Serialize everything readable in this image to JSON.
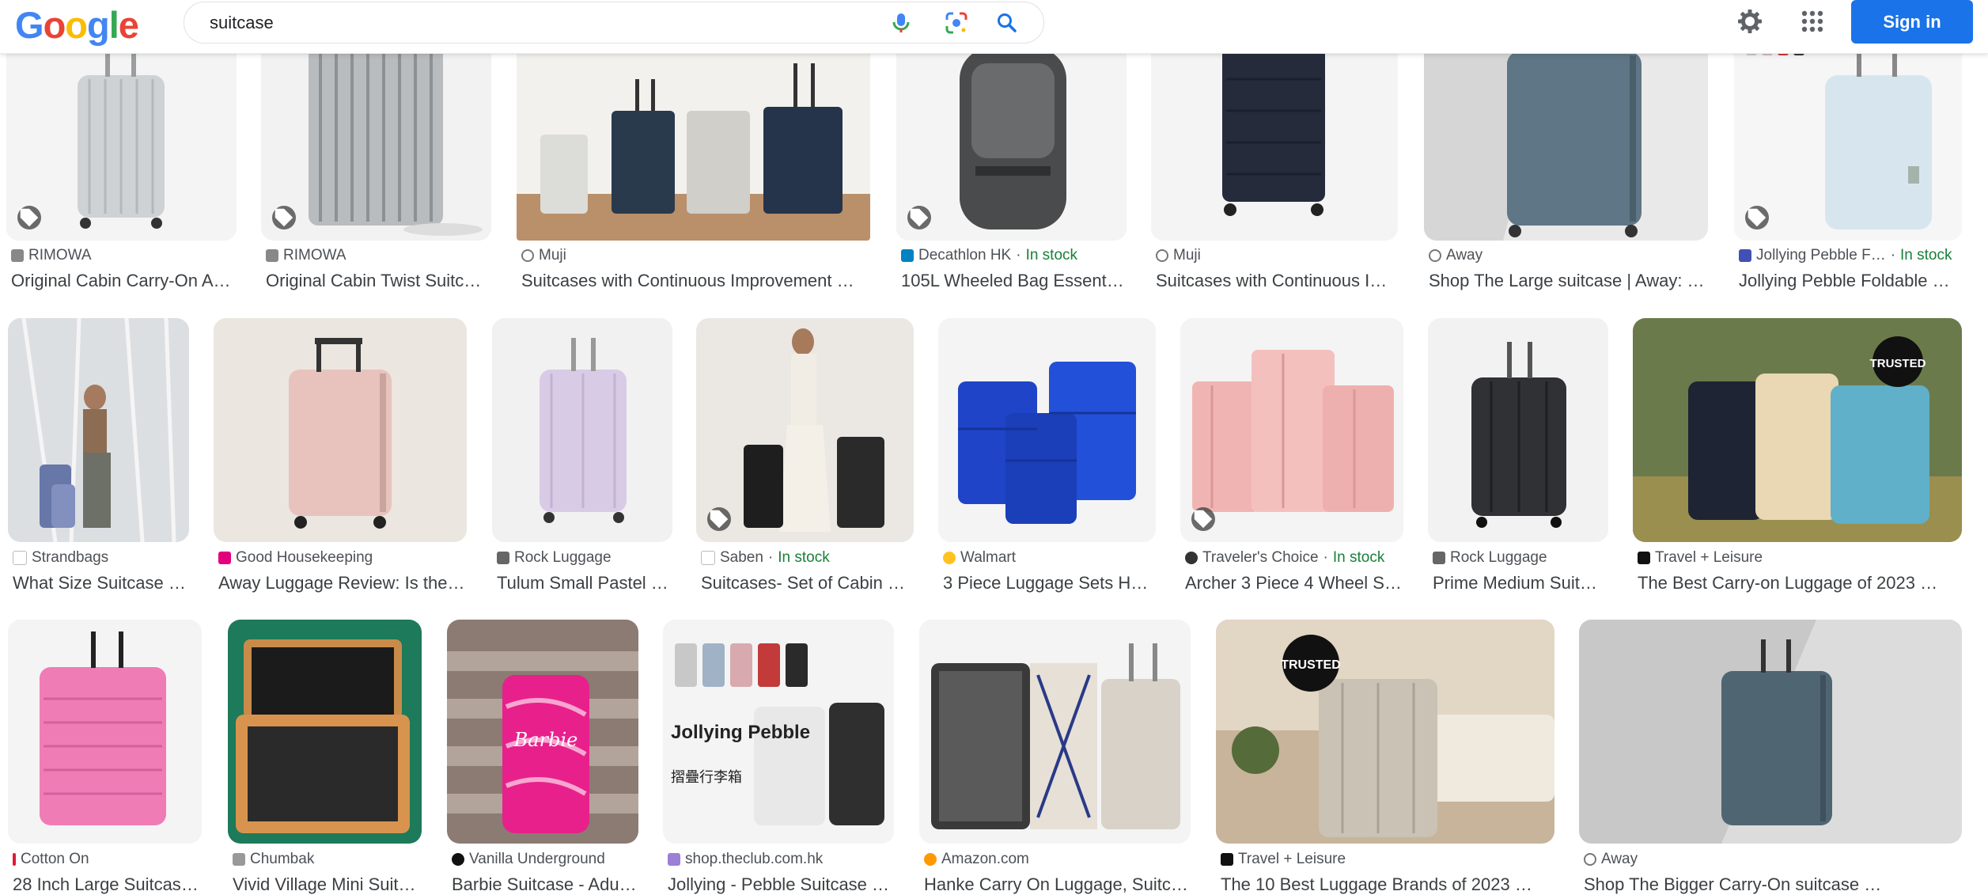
{
  "header": {
    "logo_text": "Google",
    "search_value": "suitcase",
    "signin_label": "Sign in"
  },
  "colors": {
    "accent": "#1a73e8",
    "in_stock": "#188038",
    "search_border": "#dfe1e5"
  },
  "results": [
    {
      "source": "RIMOWA",
      "stock": "",
      "title": "Original Cabin Carry-On A…",
      "icon": "rimowa-icon",
      "tag": true
    },
    {
      "source": "RIMOWA",
      "stock": "",
      "title": "Original Cabin Twist Suitc…",
      "icon": "rimowa-icon",
      "tag": true
    },
    {
      "source": "Muji",
      "stock": "",
      "title": "Suitcases with Continuous Improvement …",
      "icon": "globe-icon",
      "tag": false
    },
    {
      "source": "Decathlon HK",
      "stock": "In stock",
      "title": "105L Wheeled Bag Essent…",
      "icon": "decathlon-icon",
      "tag": true
    },
    {
      "source": "Muji",
      "stock": "",
      "title": "Suitcases with Continuous I…",
      "icon": "globe-icon",
      "tag": false
    },
    {
      "source": "Away",
      "stock": "",
      "title": "Shop The Large suitcase | Away: …",
      "icon": "away-icon",
      "tag": false
    },
    {
      "source": "Jollying Pebble F…",
      "stock": "In stock",
      "title": "Jollying Pebble Foldable …",
      "icon": "jollying-icon",
      "tag": true
    },
    {
      "source": "Strandbags",
      "stock": "",
      "title": "What Size Suitcase …",
      "icon": "strandbags-icon",
      "tag": false
    },
    {
      "source": "Good Housekeeping",
      "stock": "",
      "title": "Away Luggage Review: Is the…",
      "icon": "gh-icon",
      "tag": false
    },
    {
      "source": "Rock Luggage",
      "stock": "",
      "title": "Tulum Small Pastel …",
      "icon": "rock-icon",
      "tag": false
    },
    {
      "source": "Saben",
      "stock": "In stock",
      "title": "Suitcases- Set of Cabin …",
      "icon": "saben-icon",
      "tag": true
    },
    {
      "source": "Walmart",
      "stock": "",
      "title": "3 Piece Luggage Sets H…",
      "icon": "walmart-icon",
      "tag": false
    },
    {
      "source": "Traveler's Choice",
      "stock": "In stock",
      "title": "Archer 3 Piece 4 Wheel S…",
      "icon": "travelers-icon",
      "tag": true
    },
    {
      "source": "Rock Luggage",
      "stock": "",
      "title": "Prime Medium Suit…",
      "icon": "rock-icon",
      "tag": false
    },
    {
      "source": "Travel + Leisure",
      "stock": "",
      "title": "The Best Carry-on Luggage of 2023 …",
      "icon": "tl-icon",
      "tag": false
    },
    {
      "source": "Cotton On",
      "stock": "",
      "title": "28 Inch Large Suitcase …",
      "icon": "cottonon-icon",
      "tag": false
    },
    {
      "source": "Chumbak",
      "stock": "",
      "title": "Vivid Village Mini Suit…",
      "icon": "chumbak-icon",
      "tag": false
    },
    {
      "source": "Vanilla Underground",
      "stock": "",
      "title": "Barbie Suitcase - Adu…",
      "icon": "vanilla-icon",
      "tag": false
    },
    {
      "source": "shop.theclub.com.hk",
      "stock": "",
      "title": "Jollying - Pebble Suitcase …",
      "icon": "theclub-icon",
      "tag": false
    },
    {
      "source": "Amazon.com",
      "stock": "",
      "title": "Hanke Carry On Luggage, Suitc…",
      "icon": "amazon-icon",
      "tag": false
    },
    {
      "source": "Travel + Leisure",
      "stock": "",
      "title": "The 10 Best Luggage Brands of 2023 …",
      "icon": "tl-icon",
      "tag": false
    },
    {
      "source": "Away",
      "stock": "",
      "title": "Shop The Bigger Carry-On suitcase …",
      "icon": "away-icon",
      "tag": false
    }
  ],
  "image_text": {
    "trusted_badge": "TRUSTED",
    "jollying_brand": "Jollying Pebble",
    "jollying_cn": "摺疊行李箱",
    "barbie": "Barbie"
  }
}
